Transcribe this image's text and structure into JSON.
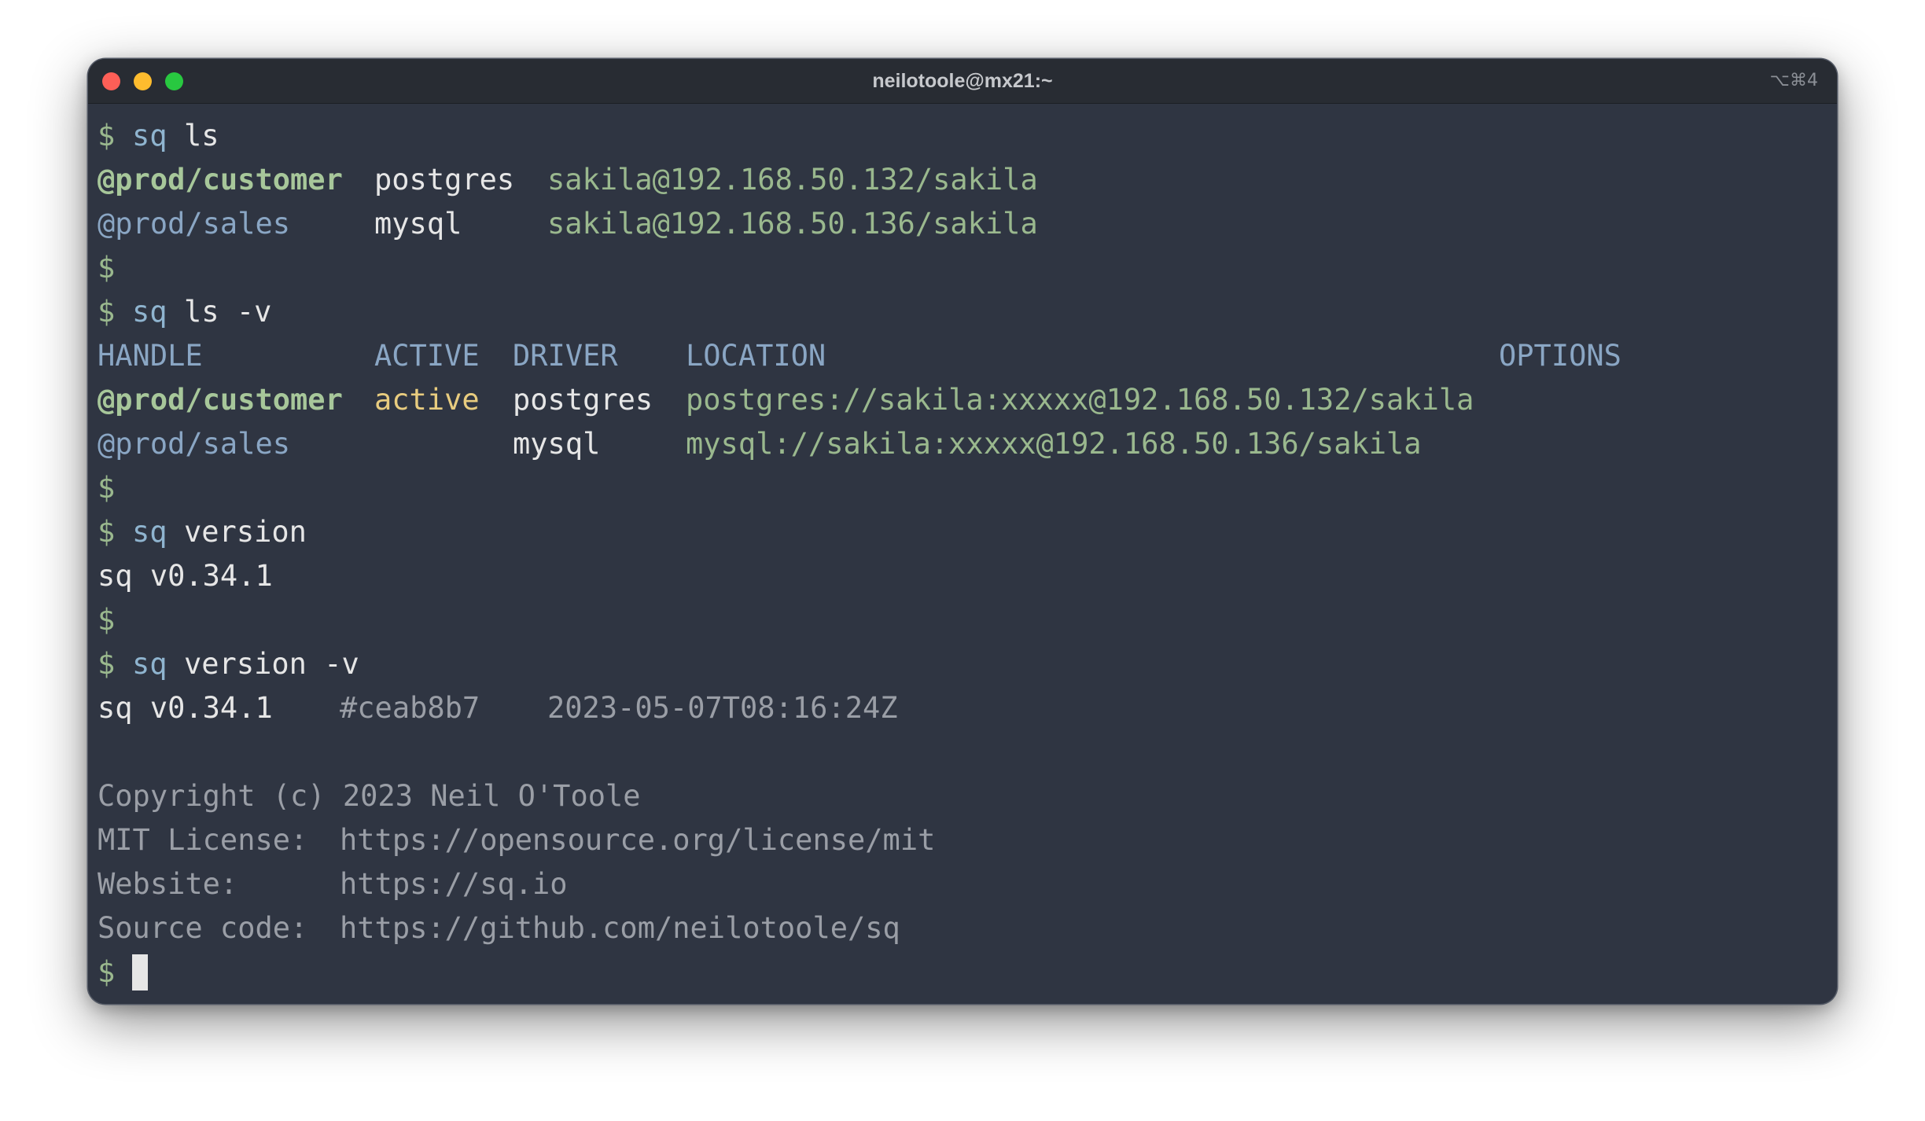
{
  "window": {
    "title": "neilotoole@mx21:~",
    "shortcut": "⌥⌘4",
    "colors": {
      "close": "#fe5f57",
      "minimize": "#febc2e",
      "zoom": "#28c840",
      "background": "#2f3542"
    }
  },
  "terminal": {
    "prompt": "$",
    "cmd_ls": {
      "program": "sq",
      "args": "ls"
    },
    "ls_rows": [
      {
        "handle": "@prod/customer",
        "driver": "postgres",
        "location": "sakila@192.168.50.132/sakila"
      },
      {
        "handle": "@prod/sales",
        "driver": "mysql",
        "location": "sakila@192.168.50.136/sakila"
      }
    ],
    "cmd_ls_v": {
      "program": "sq",
      "args": "ls -v"
    },
    "ls_v_headers": {
      "handle": "HANDLE",
      "active": "ACTIVE",
      "driver": "DRIVER",
      "location": "LOCATION",
      "options": "OPTIONS"
    },
    "ls_v_rows": [
      {
        "handle": "@prod/customer",
        "active": "active",
        "driver": "postgres",
        "location": "postgres://sakila:xxxxx@192.168.50.132/sakila"
      },
      {
        "handle": "@prod/sales",
        "active": "",
        "driver": "mysql",
        "location": "mysql://sakila:xxxxx@192.168.50.136/sakila"
      }
    ],
    "cmd_version": {
      "program": "sq",
      "args": "version"
    },
    "version_output": "sq v0.34.1",
    "cmd_version_v": {
      "program": "sq",
      "args": "version -v"
    },
    "version_v": {
      "version": "sq v0.34.1",
      "commit": "#ceab8b7",
      "timestamp": "2023-05-07T08:16:24Z"
    },
    "copyright": "Copyright (c) 2023 Neil O'Toole",
    "info": [
      {
        "label": "MIT License:",
        "value": "https://opensource.org/license/mit"
      },
      {
        "label": "Website:",
        "value": "https://sq.io"
      },
      {
        "label": "Source code:",
        "value": "https://github.com/neilotoole/sq"
      }
    ]
  }
}
